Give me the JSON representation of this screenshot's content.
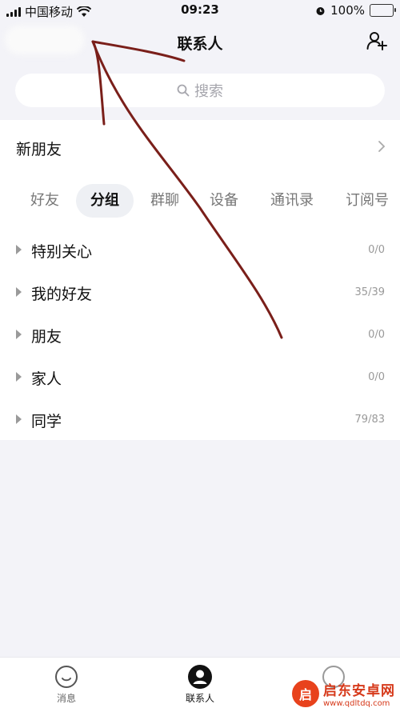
{
  "status_bar": {
    "carrier": "中国移动",
    "time": "09:23",
    "battery": "100%",
    "battery_level": 1.0
  },
  "nav": {
    "title": "联系人",
    "add_icon": "add-contact-icon"
  },
  "search": {
    "placeholder": "搜索",
    "icon": "search-icon"
  },
  "new_friends": {
    "label": "新朋友"
  },
  "tabs": [
    {
      "label": "好友",
      "active": false
    },
    {
      "label": "分组",
      "active": true
    },
    {
      "label": "群聊",
      "active": false
    },
    {
      "label": "设备",
      "active": false
    },
    {
      "label": "通讯录",
      "active": false
    },
    {
      "label": "订阅号",
      "active": false
    }
  ],
  "groups": [
    {
      "name": "特别关心",
      "count": "0/0"
    },
    {
      "name": "我的好友",
      "count": "35/39"
    },
    {
      "name": "朋友",
      "count": "0/0"
    },
    {
      "name": "家人",
      "count": "0/0"
    },
    {
      "name": "同学",
      "count": "79/83"
    }
  ],
  "tab_bar": [
    {
      "label": "消息",
      "icon": "message-icon",
      "active": false
    },
    {
      "label": "联系人",
      "icon": "contacts-icon",
      "active": true
    }
  ],
  "watermark": {
    "name": "启东安卓网",
    "url": "www.qdltdq.com",
    "logo_char": "启"
  },
  "colors": {
    "annotation": "#7a1f1a",
    "battery": "#f4c23a",
    "watermark": "#d6391a"
  }
}
